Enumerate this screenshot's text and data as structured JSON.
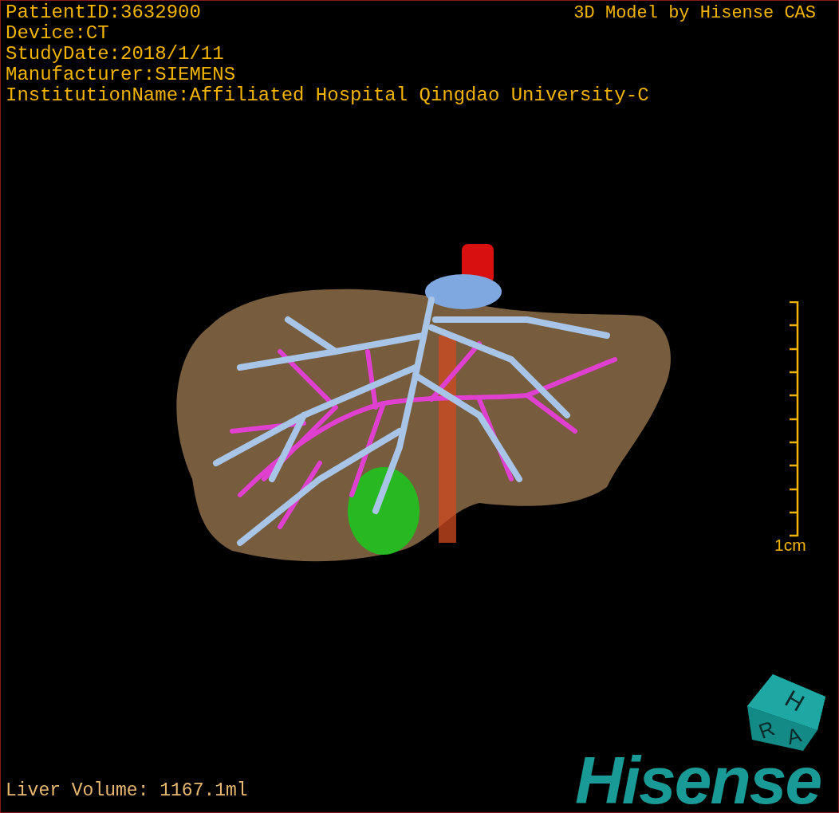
{
  "info_lines": [
    "PatientID:3632900",
    "Device:CT",
    "StudyDate:2018/1/11",
    "Manufacturer:SIEMENS",
    "InstitutionName:Affiliated Hospital Qingdao University-C"
  ],
  "model_credit": "3D Model by Hisense CAS",
  "scale_bar": {
    "label": "1cm"
  },
  "orientation_cube": {
    "top": "H",
    "left": "R",
    "right": "A"
  },
  "logo": "Hisense",
  "footer": "Liver Volume: 1167.1ml"
}
